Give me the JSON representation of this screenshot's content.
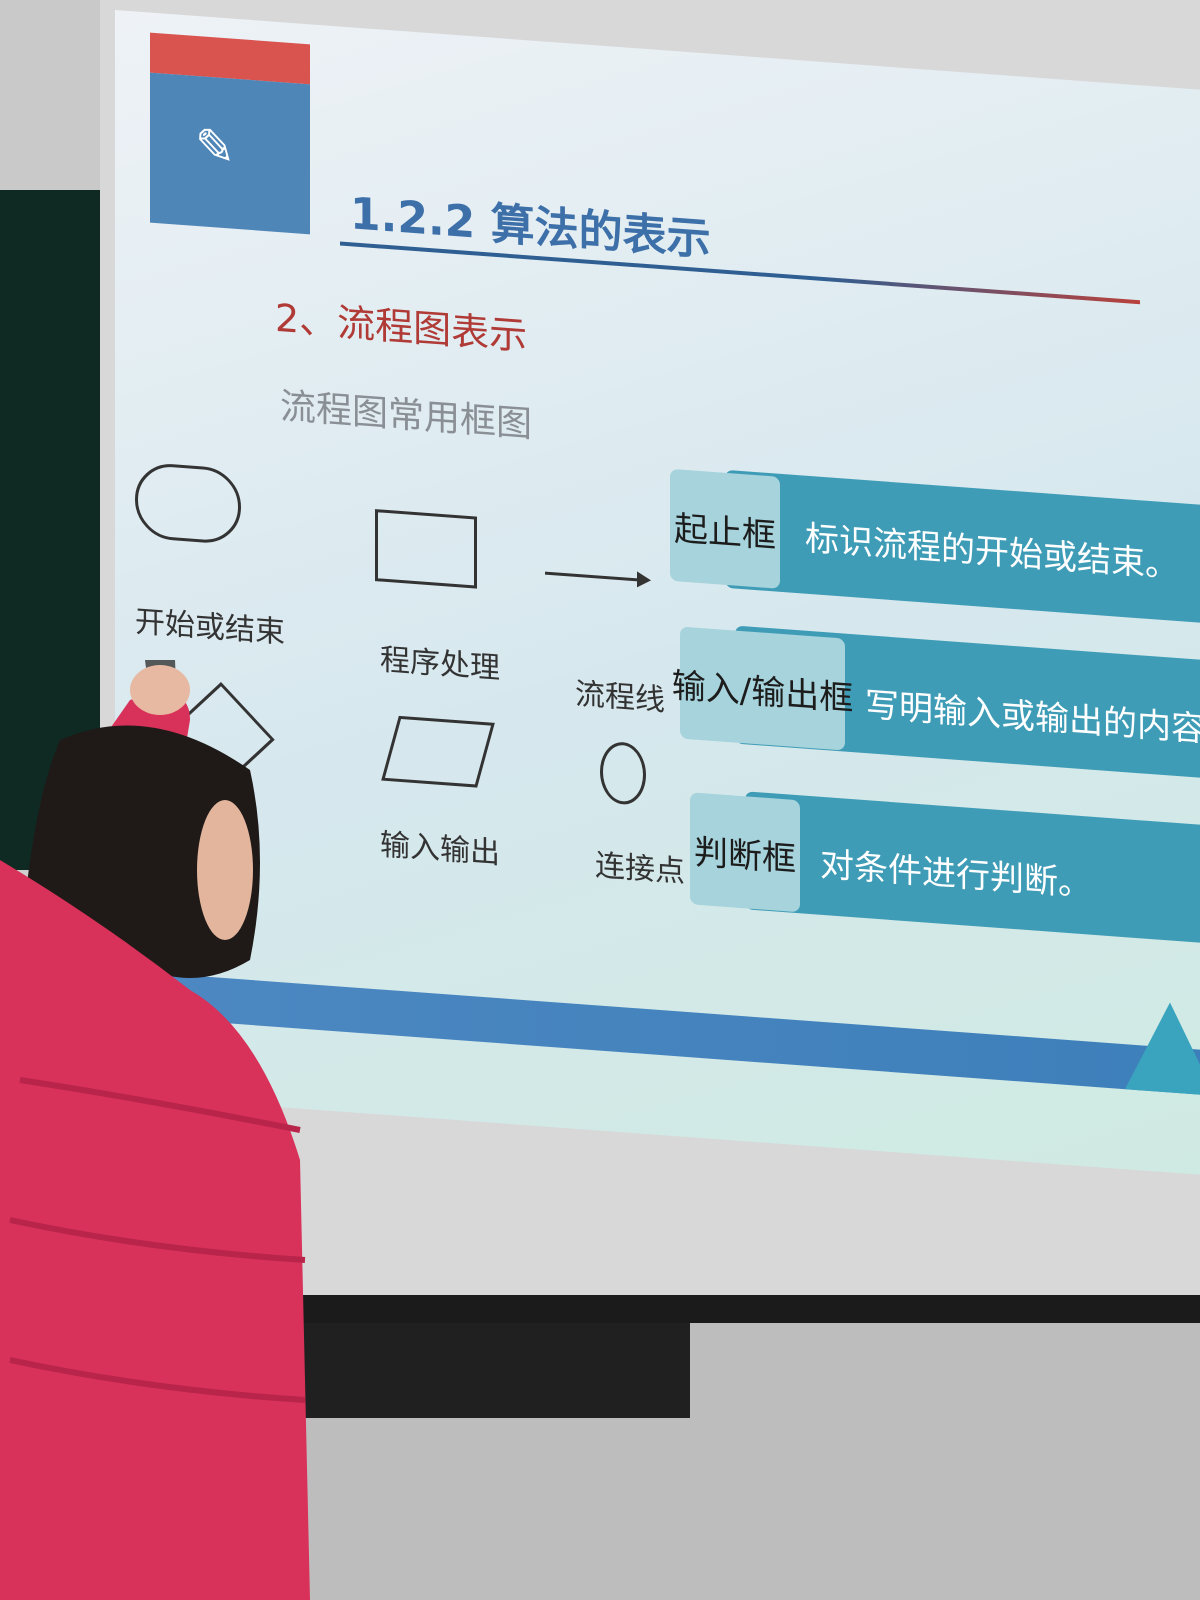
{
  "slide": {
    "title": "1.2.2 算法的表示",
    "subtitle": "2、流程图表示",
    "caption": "流程图常用框图",
    "icon": "pencil-icon",
    "shapes": [
      {
        "name": "oval",
        "label": "开始或结束"
      },
      {
        "name": "rectangle",
        "label": "程序处理"
      },
      {
        "name": "arrow",
        "label": "流程线"
      },
      {
        "name": "diamond",
        "label": ""
      },
      {
        "name": "parallelogram",
        "label": "输入输出"
      },
      {
        "name": "circle",
        "label": "连接点"
      }
    ],
    "definitions": [
      {
        "tag": "起止框",
        "description": "标识流程的开始或结束。"
      },
      {
        "tag": "输入/输出框",
        "description": "写明输入或输出的内容。"
      },
      {
        "tag": "判断框",
        "description": "对条件进行判断。"
      }
    ]
  },
  "colors": {
    "accent_blue": "#4f86b8",
    "accent_red": "#d9534f",
    "band_teal": "#3f9cb6",
    "presenter_jacket": "#d8315a"
  }
}
